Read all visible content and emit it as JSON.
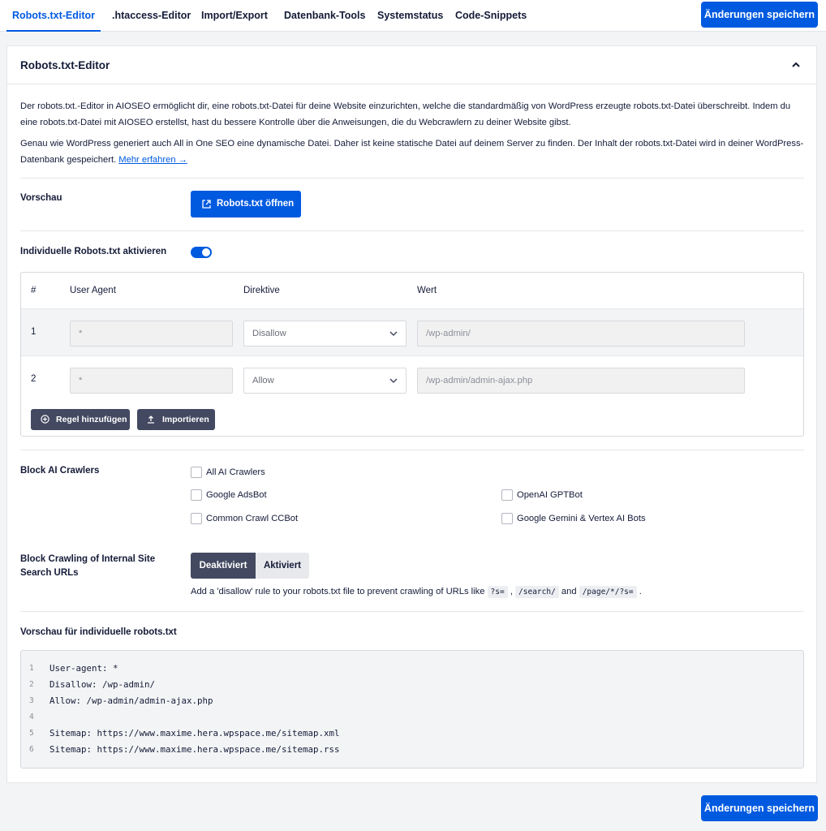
{
  "tabs": [
    {
      "label": "Robots.txt-Editor",
      "active": true
    },
    {
      "label": ".htaccess-Editor"
    },
    {
      "label": "Import/Export"
    },
    {
      "label": "Datenbank-Tools"
    },
    {
      "label": "Systemstatus"
    },
    {
      "label": "Code-Snippets"
    }
  ],
  "save_label": "Änderungen speichern",
  "card": {
    "title": "Robots.txt-Editor",
    "desc1": "Der robots.txt.-Editor in AIOSEO ermöglicht dir, eine robots.txt-Datei für deine Website einzurichten, welche die standardmäßig von WordPress erzeugte robots.txt-Datei überschreibt. Indem du eine robots.txt-Datei mit AIOSEO erstellst, hast du bessere Kontrolle über die Anweisungen, die du Webcrawlern zu deiner Website gibst.",
    "desc2": "Genau wie WordPress generiert auch All in One SEO eine dynamische Datei. Daher ist keine statische Datei auf deinem Server zu finden. Der Inhalt der robots.txt-Datei wird in deiner WordPress-Datenbank gespeichert.",
    "more_link": "Mehr erfahren →"
  },
  "preview": {
    "label": "Vorschau",
    "button": "Robots.txt öffnen"
  },
  "custom": {
    "label": "Individuelle Robots.txt aktivieren",
    "enabled": true
  },
  "table": {
    "headers": [
      "#",
      "User Agent",
      "Direktive",
      "Wert"
    ],
    "rows": [
      {
        "num": "1",
        "agent": "*",
        "directive": "Disallow",
        "value": "/wp-admin/"
      },
      {
        "num": "2",
        "agent": "*",
        "directive": "Allow",
        "value": "/wp-admin/admin-ajax.php"
      }
    ],
    "add_rule": "Regel hinzufügen",
    "import": "Importieren"
  },
  "ai": {
    "label": "Block AI Crawlers",
    "options": [
      "All AI Crawlers",
      "Google AdsBot",
      "OpenAI GPTBot",
      "Common Crawl CCBot",
      "Google Gemini & Vertex AI Bots"
    ]
  },
  "search": {
    "label": "Block Crawling of Internal Site Search URLs",
    "off": "Deaktiviert",
    "on": "Aktiviert",
    "hint_pre": "Add a 'disallow' rule to your robots.txt file to prevent crawling of URLs like",
    "code1": "?s=",
    "code2": "/search/",
    "and": "and",
    "code3": "/page/*/?s="
  },
  "robots_preview": {
    "label": "Vorschau für individuelle robots.txt",
    "lines": [
      {
        "n": "1",
        "t": "User-agent: *"
      },
      {
        "n": "2",
        "t": "Disallow: /wp-admin/"
      },
      {
        "n": "3",
        "t": "Allow: /wp-admin/admin-ajax.php"
      },
      {
        "n": "4",
        "t": ""
      },
      {
        "n": "5",
        "t": "Sitemap: https://www.maxime.hera.wpspace.me/sitemap.xml"
      },
      {
        "n": "6",
        "t": "Sitemap: https://www.maxime.hera.wpspace.me/sitemap.rss"
      }
    ]
  },
  "colors": {
    "accent": "#005ae0",
    "dark_button": "#434960",
    "text": "#141b38"
  }
}
